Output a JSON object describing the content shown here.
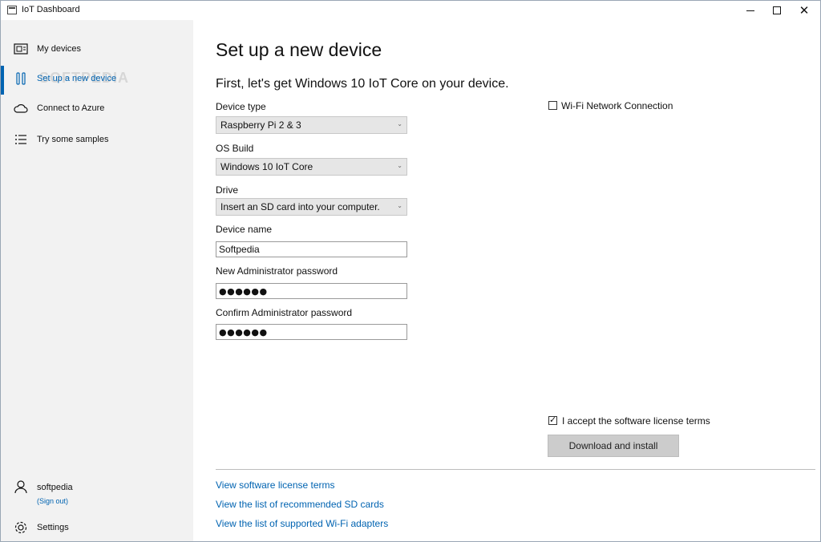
{
  "window": {
    "title": "IoT Dashboard",
    "minimize_symbol": "",
    "close_symbol": "✕"
  },
  "sidebar": {
    "items": [
      {
        "label": "My devices",
        "icon": "devices-icon"
      },
      {
        "label": "Set up a new device",
        "icon": "setup-icon",
        "active": true
      },
      {
        "label": "Connect to Azure",
        "icon": "cloud-icon"
      },
      {
        "label": "Try some samples",
        "icon": "list-icon"
      }
    ],
    "watermark": "SOFTPEDIA",
    "user": {
      "name": "softpedia",
      "signout": "(Sign out)"
    },
    "settings_label": "Settings"
  },
  "main": {
    "title": "Set up a new device",
    "subtitle": "First, let's get Windows 10 IoT Core on your device.",
    "device_type": {
      "label": "Device type",
      "value": "Raspberry Pi 2 & 3"
    },
    "os_build": {
      "label": "OS Build",
      "value": "Windows 10 IoT Core"
    },
    "drive": {
      "label": "Drive",
      "value": "Insert an SD card into your computer."
    },
    "device_name": {
      "label": "Device name",
      "value": "Softpedia"
    },
    "new_password": {
      "label": "New Administrator password",
      "value": "●●●●●●"
    },
    "confirm_password": {
      "label": "Confirm Administrator password",
      "value": "●●●●●●"
    },
    "dropdown_arrow": "⌄",
    "wifi": {
      "label": "Wi-Fi Network Connection",
      "checked": false
    },
    "license_accept": {
      "label": "I accept the software license terms",
      "checked": true,
      "tick": "✓"
    },
    "download_button": "Download and install",
    "links": [
      "View software license terms",
      "View the list of recommended SD cards",
      "View the list of supported Wi-Fi adapters"
    ]
  },
  "colors": {
    "accent": "#0063b1",
    "sidebar_bg": "#f2f2f2",
    "button_disabled_bg": "#cccccc"
  }
}
